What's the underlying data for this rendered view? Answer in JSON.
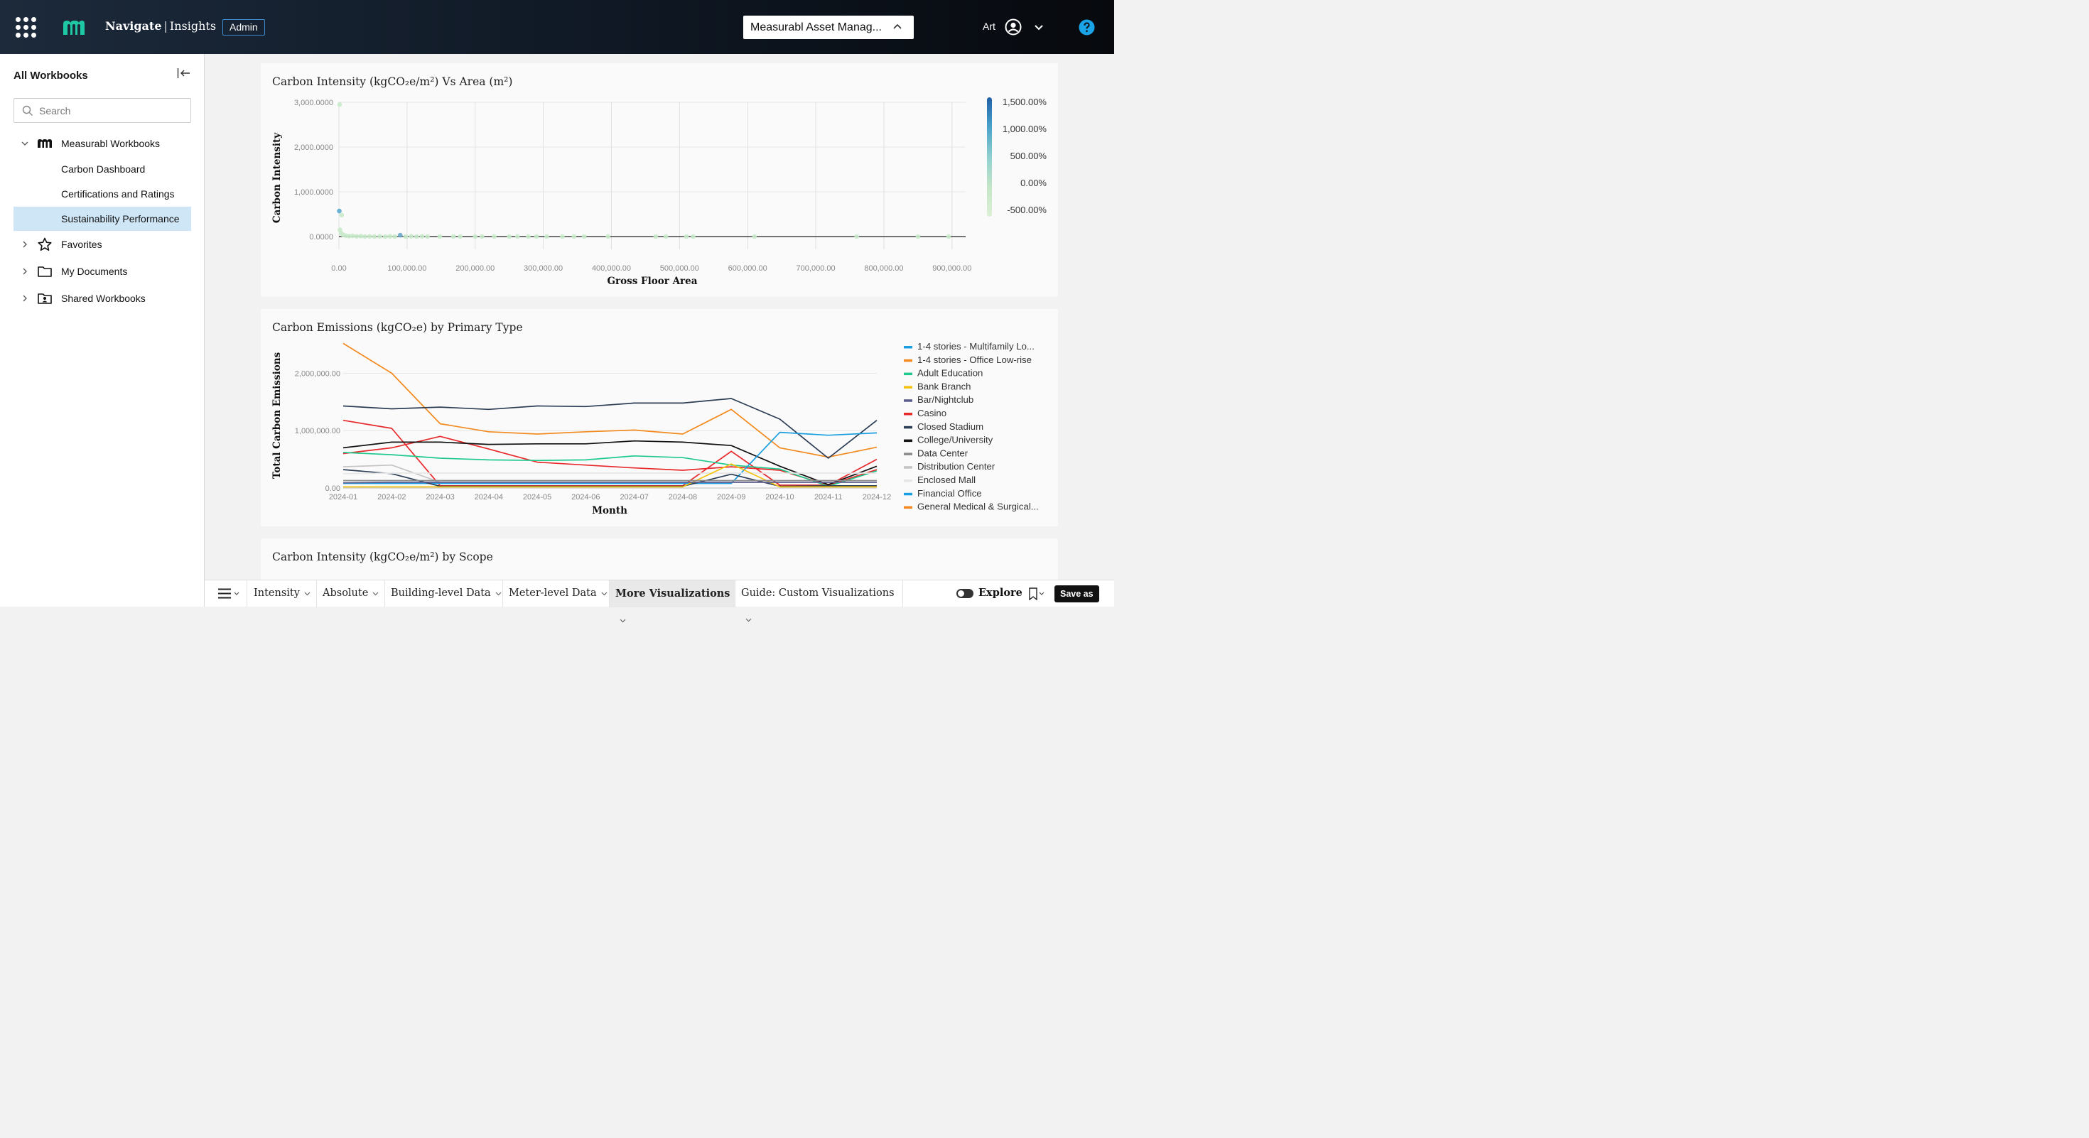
{
  "header": {
    "brand_bold": "Navigate",
    "brand_sep": "|",
    "brand_light": "Insights",
    "admin_label": "Admin",
    "org_selector": "Measurabl Asset Manag...",
    "user_name": "Art",
    "help_icon": "help-icon",
    "apps_icon": "apps-grid-icon"
  },
  "sidebar": {
    "title": "All Workbooks",
    "search_placeholder": "Search",
    "tree": [
      {
        "label": "Measurabl Workbooks",
        "icon": "measurabl-logo-icon",
        "expanded": true
      },
      {
        "label": "Carbon Dashboard"
      },
      {
        "label": "Certifications and Ratings"
      },
      {
        "label": "Sustainability Performance",
        "selected": true
      },
      {
        "label": "Favorites",
        "icon": "star-icon",
        "expanded": false
      },
      {
        "label": "My Documents",
        "icon": "folder-icon",
        "expanded": false
      },
      {
        "label": "Shared Workbooks",
        "icon": "shared-folder-icon",
        "expanded": false
      }
    ]
  },
  "cards": {
    "scatter_title": "Carbon Intensity (kgCO₂e/m²) Vs Area (m²)",
    "line_title": "Carbon Emissions (kgCO₂e) by Primary Type",
    "scope_title": "Carbon Intensity (kgCO₂e/m²) by Scope"
  },
  "chart_data": [
    {
      "type": "scatter",
      "title": "Carbon Intensity (kgCO₂e/m²) Vs Area (m²)",
      "xlabel": "Gross Floor Area",
      "ylabel": "Carbon Intensity",
      "xlim": [
        0,
        920000
      ],
      "ylim": [
        0,
        3000
      ],
      "x_ticks": [
        "0.00",
        "100,000.00",
        "200,000.00",
        "300,000.00",
        "400,000.00",
        "500,000.00",
        "600,000.00",
        "700,000.00",
        "800,000.00",
        "900,000.00"
      ],
      "x_tick_values": [
        0,
        100000,
        200000,
        300000,
        400000,
        500000,
        600000,
        700000,
        800000,
        900000
      ],
      "y_ticks": [
        "0.0000",
        "1,000.0000",
        "2,000.0000",
        "3,000.0000"
      ],
      "y_tick_values": [
        0,
        1000,
        2000,
        3000
      ],
      "color_legend": {
        "labels": [
          "1,500.00%",
          "1,000.00%",
          "500.00%",
          "0.00%",
          "-500.00%"
        ],
        "colors": [
          "#1f5fa8",
          "#4aa3c9",
          "#8fd0d0",
          "#c3e6c6",
          "#dcf1d6"
        ]
      },
      "grid": true,
      "points": [
        {
          "x": 1000,
          "y": 2950,
          "c": "#c8e9c9"
        },
        {
          "x": 500,
          "y": 570,
          "c": "#5aa9cf"
        },
        {
          "x": 4000,
          "y": 480,
          "c": "#c8e9c9"
        },
        {
          "x": 1500,
          "y": 150,
          "c": "#c8e9c9"
        },
        {
          "x": 3000,
          "y": 80,
          "c": "#c8e9c9"
        },
        {
          "x": 6000,
          "y": 40,
          "c": "#c8e9c9"
        },
        {
          "x": 10000,
          "y": 20,
          "c": "#c8e9c9"
        },
        {
          "x": 15000,
          "y": 10,
          "c": "#c8e9c9"
        },
        {
          "x": 20000,
          "y": 15,
          "c": "#c8e9c9"
        },
        {
          "x": 26000,
          "y": 5,
          "c": "#c8e9c9"
        },
        {
          "x": 32000,
          "y": 10,
          "c": "#c8e9c9"
        },
        {
          "x": 38000,
          "y": 0,
          "c": "#c8e9c9"
        },
        {
          "x": 45000,
          "y": 5,
          "c": "#c8e9c9"
        },
        {
          "x": 52000,
          "y": 0,
          "c": "#c8e9c9"
        },
        {
          "x": 60000,
          "y": 5,
          "c": "#c8e9c9"
        },
        {
          "x": 68000,
          "y": 0,
          "c": "#c8e9c9"
        },
        {
          "x": 75000,
          "y": 5,
          "c": "#c8e9c9"
        },
        {
          "x": 82000,
          "y": 0,
          "c": "#c8e9c9"
        },
        {
          "x": 90000,
          "y": 30,
          "c": "#6aa6c9"
        },
        {
          "x": 98000,
          "y": 0,
          "c": "#c8e9c9"
        },
        {
          "x": 106000,
          "y": 5,
          "c": "#c8e9c9"
        },
        {
          "x": 114000,
          "y": 0,
          "c": "#c8e9c9"
        },
        {
          "x": 122000,
          "y": 5,
          "c": "#c8e9c9"
        },
        {
          "x": 130000,
          "y": 0,
          "c": "#c8e9c9"
        },
        {
          "x": 148000,
          "y": 0,
          "c": "#c8e9c9"
        },
        {
          "x": 168000,
          "y": 0,
          "c": "#c8e9c9"
        },
        {
          "x": 178000,
          "y": 0,
          "c": "#c8e9c9"
        },
        {
          "x": 200000,
          "y": 0,
          "c": "#c8e9c9"
        },
        {
          "x": 210000,
          "y": 0,
          "c": "#c8e9c9"
        },
        {
          "x": 228000,
          "y": 0,
          "c": "#c8e9c9"
        },
        {
          "x": 250000,
          "y": 0,
          "c": "#c8e9c9"
        },
        {
          "x": 262000,
          "y": 0,
          "c": "#c8e9c9"
        },
        {
          "x": 278000,
          "y": 0,
          "c": "#c8e9c9"
        },
        {
          "x": 290000,
          "y": 0,
          "c": "#c8e9c9"
        },
        {
          "x": 305000,
          "y": 0,
          "c": "#c8e9c9"
        },
        {
          "x": 328000,
          "y": 0,
          "c": "#c8e9c9"
        },
        {
          "x": 345000,
          "y": 0,
          "c": "#c8e9c9"
        },
        {
          "x": 360000,
          "y": 0,
          "c": "#c8e9c9"
        },
        {
          "x": 395000,
          "y": 0,
          "c": "#c8e9c9"
        },
        {
          "x": 465000,
          "y": 0,
          "c": "#c8e9c9"
        },
        {
          "x": 480000,
          "y": 0,
          "c": "#c8e9c9"
        },
        {
          "x": 510000,
          "y": 0,
          "c": "#c8e9c9"
        },
        {
          "x": 520000,
          "y": 0,
          "c": "#c8e9c9"
        },
        {
          "x": 610000,
          "y": 0,
          "c": "#c8e9c9"
        },
        {
          "x": 760000,
          "y": 0,
          "c": "#c8e9c9"
        },
        {
          "x": 850000,
          "y": 0,
          "c": "#c8e9c9"
        },
        {
          "x": 895000,
          "y": 0,
          "c": "#c8e9c9"
        }
      ]
    },
    {
      "type": "line",
      "title": "Carbon Emissions (kgCO₂e) by Primary Type",
      "xlabel": "Month",
      "ylabel": "Total Carbon Emissions",
      "categories": [
        "2024-01",
        "2024-02",
        "2024-03",
        "2024-04",
        "2024-05",
        "2024-06",
        "2024-07",
        "2024-08",
        "2024-09",
        "2024-10",
        "2024-11",
        "2024-12"
      ],
      "ylim": [
        0,
        2500000
      ],
      "y_ticks": [
        "0.00",
        "1,000,000.00",
        "2,000,000.00"
      ],
      "y_tick_values": [
        0,
        1000000,
        2000000
      ],
      "legend_position": "right",
      "legend": [
        {
          "name": "1-4 stories - Multifamily Lo...",
          "color": "#1a9ee0"
        },
        {
          "name": "1-4 stories - Office Low-rise",
          "color": "#f28a1f"
        },
        {
          "name": "Adult Education",
          "color": "#1fc98e"
        },
        {
          "name": "Bank Branch",
          "color": "#f4c20d"
        },
        {
          "name": "Bar/Nightclub",
          "color": "#5a5a8c"
        },
        {
          "name": "Casino",
          "color": "#e8292b"
        },
        {
          "name": "Closed Stadium",
          "color": "#2c3e55"
        },
        {
          "name": "College/University",
          "color": "#111111"
        },
        {
          "name": "Data Center",
          "color": "#8a8a8a"
        },
        {
          "name": "Distribution Center",
          "color": "#c4c4c4"
        },
        {
          "name": "Enclosed Mall",
          "color": "#e6e6e6"
        },
        {
          "name": "Financial Office",
          "color": "#1a9ee0"
        },
        {
          "name": "General Medical & Surgical...",
          "color": "#f28a1f"
        }
      ],
      "series": [
        {
          "color": "#f28a1f",
          "values": [
            2520000,
            2000000,
            1120000,
            980000,
            940000,
            980000,
            1010000,
            940000,
            1370000,
            700000,
            540000,
            710000
          ]
        },
        {
          "color": "#2c3e55",
          "values": [
            1430000,
            1380000,
            1410000,
            1370000,
            1430000,
            1420000,
            1480000,
            1480000,
            1560000,
            1200000,
            520000,
            1180000
          ]
        },
        {
          "color": "#e8292b",
          "values": [
            1180000,
            1040000,
            40000,
            40000,
            40000,
            40000,
            40000,
            40000,
            640000,
            50000,
            50000,
            500000
          ]
        },
        {
          "color": "#e8292b",
          "values": [
            600000,
            700000,
            900000,
            680000,
            450000,
            400000,
            350000,
            310000,
            370000,
            310000,
            50000,
            320000
          ]
        },
        {
          "color": "#111111",
          "values": [
            700000,
            800000,
            800000,
            760000,
            770000,
            770000,
            820000,
            800000,
            740000,
            380000,
            60000,
            380000
          ]
        },
        {
          "color": "#1fc98e",
          "values": [
            620000,
            580000,
            520000,
            490000,
            480000,
            490000,
            560000,
            530000,
            400000,
            330000,
            30000,
            300000
          ]
        },
        {
          "color": "#1a9ee0",
          "values": [
            80000,
            80000,
            80000,
            80000,
            80000,
            80000,
            80000,
            80000,
            80000,
            970000,
            920000,
            960000
          ]
        },
        {
          "color": "#2c3e55",
          "values": [
            320000,
            250000,
            30000,
            30000,
            30000,
            30000,
            30000,
            30000,
            240000,
            30000,
            40000,
            40000
          ]
        },
        {
          "color": "#c4c4c4",
          "values": [
            370000,
            400000,
            100000,
            100000,
            100000,
            100000,
            100000,
            100000,
            100000,
            100000,
            100000,
            100000
          ]
        },
        {
          "color": "#e6e6e6",
          "values": [
            250000,
            260000,
            260000,
            260000,
            260000,
            260000,
            260000,
            260000,
            260000,
            260000,
            260000,
            260000
          ]
        },
        {
          "color": "#f4c20d",
          "values": [
            20000,
            20000,
            20000,
            20000,
            20000,
            20000,
            20000,
            20000,
            420000,
            20000,
            20000,
            20000
          ]
        },
        {
          "color": "#5a5a8c",
          "values": [
            90000,
            100000,
            100000,
            100000,
            100000,
            100000,
            100000,
            100000,
            100000,
            100000,
            100000,
            100000
          ]
        },
        {
          "color": "#8a8a8a",
          "values": [
            130000,
            130000,
            130000,
            130000,
            130000,
            130000,
            130000,
            130000,
            130000,
            130000,
            130000,
            130000
          ]
        }
      ]
    }
  ],
  "bottom_tabs": {
    "menu_icon": "hamburger-icon",
    "tabs": [
      "Intensity",
      "Absolute",
      "Building-level Data",
      "Meter-level Data",
      "More Visualizations",
      "Guide: Custom Visualizations"
    ],
    "active_index": 4,
    "explore_label": "Explore",
    "save_label": "Save as"
  }
}
